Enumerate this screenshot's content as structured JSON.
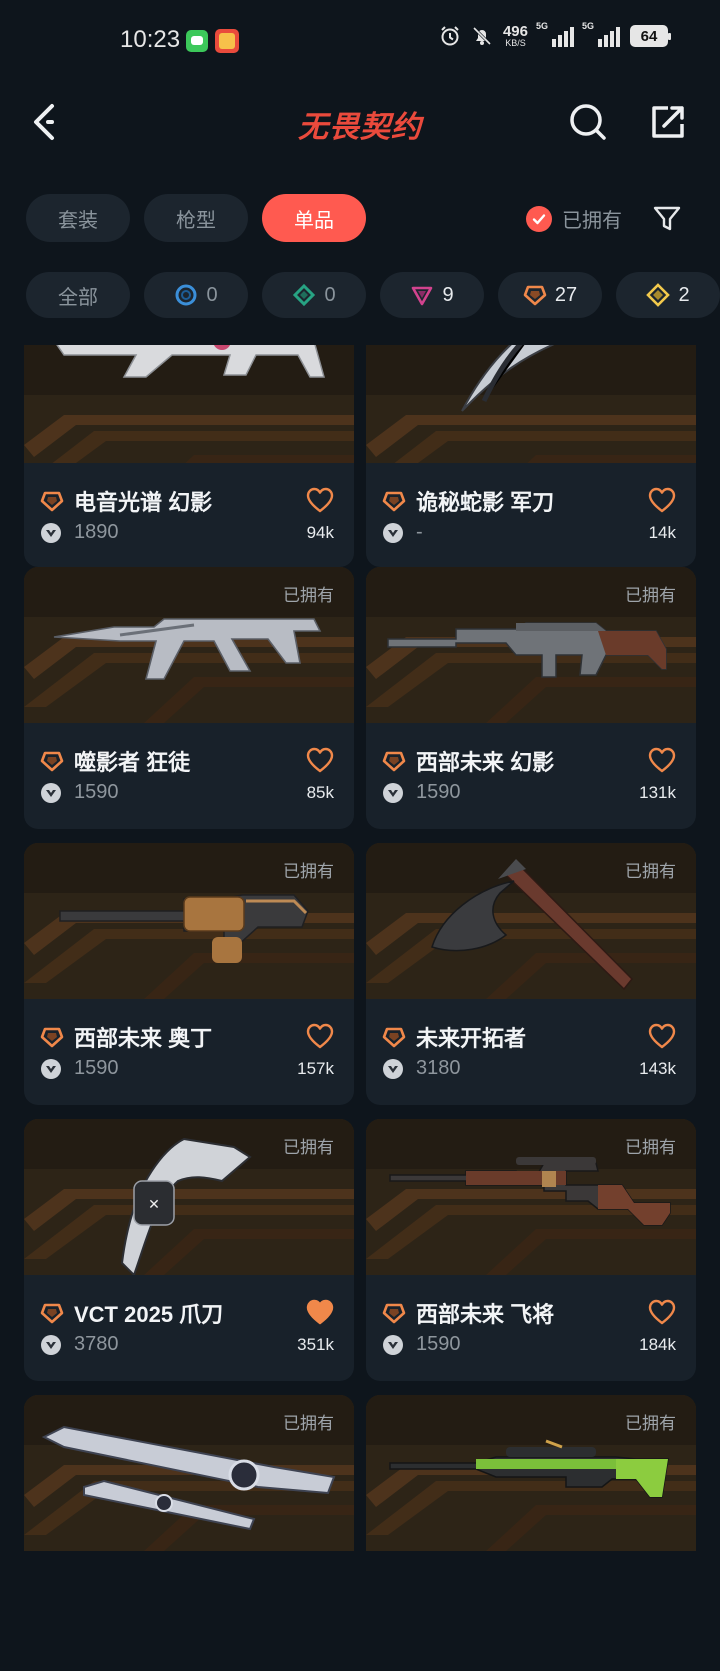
{
  "status": {
    "time": "10:23",
    "net_speed": "496",
    "net_unit": "KB/S",
    "sig1_label": "5G",
    "sig2_label": "5G",
    "battery": "64"
  },
  "header": {
    "title": "无畏契约"
  },
  "tabs": [
    {
      "label": "套装"
    },
    {
      "label": "枪型"
    },
    {
      "label": "单品",
      "active": true
    }
  ],
  "owned_filter": {
    "label": "已拥有",
    "checked": true
  },
  "rarity_filters": [
    {
      "label": "全部"
    },
    {
      "count": "0",
      "color": "#3b8fd9"
    },
    {
      "count": "0",
      "color": "#27a383"
    },
    {
      "count": "9",
      "color": "#d2438e"
    },
    {
      "count": "27",
      "color": "#f0884a"
    },
    {
      "count": "2",
      "color": "#f2c94c"
    }
  ],
  "items": [
    {
      "name": "电音光谱 幻影",
      "price": "1890",
      "likes": "94k",
      "owned": false,
      "favorited": false,
      "weapon": "rifle-white"
    },
    {
      "name": "诡秘蛇影 军刀",
      "price": "-",
      "likes": "14k",
      "owned": false,
      "favorited": false,
      "weapon": "claw-dark"
    },
    {
      "name": "噬影者 狂徒",
      "price": "1590",
      "likes": "85k",
      "owned": true,
      "owned_label": "已拥有",
      "favorited": false,
      "weapon": "rifle-silver"
    },
    {
      "name": "西部未来 幻影",
      "price": "1590",
      "likes": "131k",
      "owned": true,
      "owned_label": "已拥有",
      "favorited": false,
      "weapon": "rifle-wood"
    },
    {
      "name": "西部未来 奥丁",
      "price": "1590",
      "likes": "157k",
      "owned": true,
      "owned_label": "已拥有",
      "favorited": false,
      "weapon": "minigun-brass"
    },
    {
      "name": "未来开拓者",
      "price": "3180",
      "likes": "143k",
      "owned": true,
      "owned_label": "已拥有",
      "favorited": false,
      "weapon": "axe"
    },
    {
      "name": "VCT 2025 爪刀",
      "price": "3780",
      "likes": "351k",
      "owned": true,
      "owned_label": "已拥有",
      "favorited": true,
      "weapon": "karambit"
    },
    {
      "name": "西部未来 飞将",
      "price": "1590",
      "likes": "184k",
      "owned": true,
      "owned_label": "已拥有",
      "favorited": false,
      "weapon": "lever-rifle"
    },
    {
      "name": "",
      "price": "",
      "likes": "",
      "owned": true,
      "owned_label": "已拥有",
      "favorited": false,
      "weapon": "blades"
    },
    {
      "name": "",
      "price": "",
      "likes": "",
      "owned": true,
      "owned_label": "已拥有",
      "favorited": false,
      "weapon": "sniper-green"
    }
  ],
  "colors": {
    "accent": "#ff5a50",
    "tier_orange": "#f0884a",
    "background": "#0e151c",
    "card_bg": "#18212a"
  }
}
